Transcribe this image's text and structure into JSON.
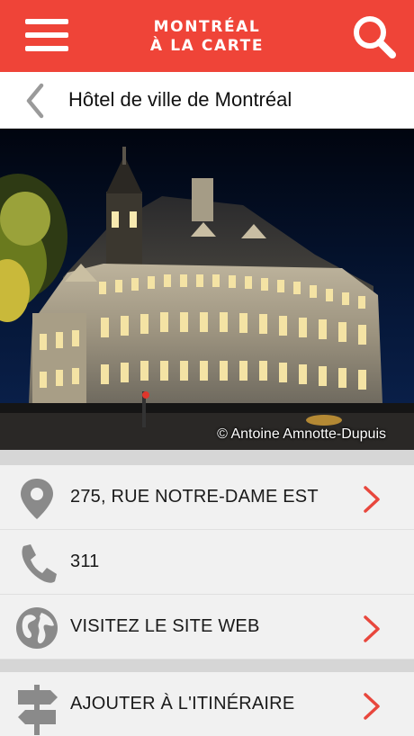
{
  "header": {
    "title_line1": "MONTRÉAL",
    "title_line2": "À LA CARTE",
    "menu_icon": "hamburger-menu-icon",
    "search_icon": "search-icon",
    "brand_color": "#ef4438"
  },
  "nav": {
    "back_icon": "chevron-left-icon",
    "title": "Hôtel de ville de Montréal"
  },
  "photo": {
    "credit": "© Antoine Amnotte-Dupuis"
  },
  "details": [
    {
      "icon": "map-pin-icon",
      "label": "275, RUE NOTRE-DAME EST",
      "has_arrow": true
    },
    {
      "icon": "phone-icon",
      "label": "311",
      "has_arrow": false
    },
    {
      "icon": "globe-icon",
      "label": "VISITEZ LE SITE WEB",
      "has_arrow": true
    }
  ],
  "actions": [
    {
      "icon": "signpost-icon",
      "label": "AJOUTER À L'ITINÉRAIRE",
      "has_arrow": true
    }
  ],
  "colors": {
    "icon_gray": "#8a8a8a",
    "arrow_red": "#e8473d"
  }
}
